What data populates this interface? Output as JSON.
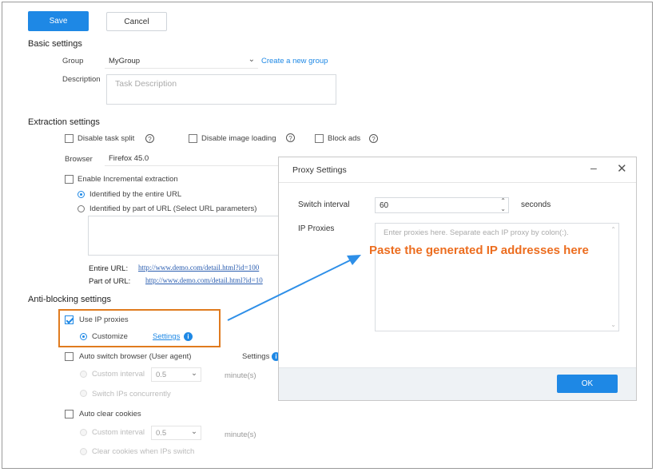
{
  "toolbar": {
    "save_label": "Save",
    "cancel_label": "Cancel"
  },
  "basic": {
    "title": "Basic settings",
    "group_label": "Group",
    "group_value": "MyGroup",
    "create_group_link": "Create a new group",
    "description_label": "Description",
    "description_placeholder": "Task Description"
  },
  "extraction": {
    "title": "Extraction settings",
    "disable_split": "Disable task split",
    "disable_images": "Disable image loading",
    "block_ads": "Block ads",
    "browser_label": "Browser",
    "browser_value": "Firefox 45.0",
    "incremental": "Enable Incremental extraction",
    "identified_entire": "Identified by the entire URL",
    "identified_part": "Identified by part of URL (Select URL parameters)",
    "entire_url_label": "Entire URL:",
    "entire_url_value": "http://www.demo.com/detail.html?id=100",
    "part_url_label": "Part of URL:",
    "part_url_value": "http://www.demo.com/detail.html?id=10"
  },
  "antiblock": {
    "title": "Anti-blocking settings",
    "use_ip_proxies": "Use IP proxies",
    "customize": "Customize",
    "settings_link": "Settings",
    "auto_switch_browser": "Auto switch browser (User agent)",
    "settings_label": "Settings",
    "custom_interval_1": "Custom interval",
    "interval_value_1": "0.5",
    "minutes_1": "minute(s)",
    "switch_ips": "Switch IPs concurrently",
    "auto_clear_cookies": "Auto clear cookies",
    "custom_interval_2": "Custom interval",
    "interval_value_2": "0.5",
    "minutes_2": "minute(s)",
    "clear_cookies_when": "Clear cookies when IPs switch"
  },
  "dialog": {
    "title": "Proxy Settings",
    "switch_interval_label": "Switch interval",
    "switch_interval_value": "60",
    "seconds_label": "seconds",
    "ip_proxies_label": "IP Proxies",
    "ip_proxies_placeholder": "Enter proxies here. Separate each IP proxy by colon(:).",
    "ok_label": "OK"
  },
  "annotation": {
    "text": "Paste the generated IP addresses here"
  },
  "colors": {
    "accent": "#1e88e5",
    "annotation_orange": "#e07b1f",
    "annotation_text": "#ec6d1f"
  },
  "icons": [
    "help-icon",
    "info-icon",
    "chevron-down-icon",
    "minimize-icon",
    "close-icon",
    "checkmark-icon",
    "arrow-icon"
  ]
}
